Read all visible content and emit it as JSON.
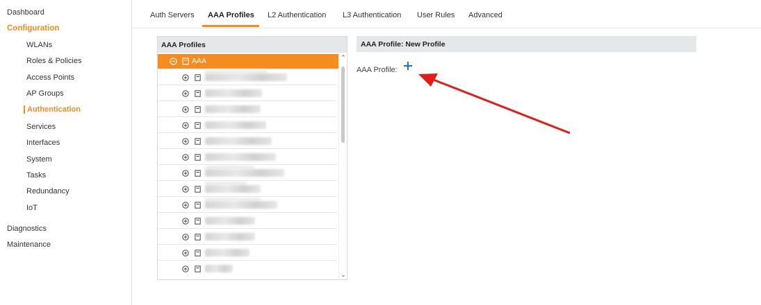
{
  "sidebar": {
    "dashboard": "Dashboard",
    "configuration": "Configuration",
    "items": [
      "WLANs",
      "Roles & Policies",
      "Access Points",
      "AP Groups",
      "Authentication",
      "Services",
      "Interfaces",
      "System",
      "Tasks",
      "Redundancy",
      "IoT"
    ],
    "diagnostics": "Diagnostics",
    "maintenance": "Maintenance"
  },
  "tabs": [
    "Auth Servers",
    "AAA Profiles",
    "L2 Authentication",
    "L3 Authentication",
    "User Rules",
    "Advanced"
  ],
  "left_panel": {
    "title": "AAA Profiles",
    "selected_label": "AAA"
  },
  "right_panel": {
    "title": "AAA Profile: New Profile",
    "field_label": "AAA Profile:"
  },
  "colors": {
    "accent": "#f68b1f",
    "add_icon": "#1a73c8",
    "annotation_arrow": "#e21b1b"
  }
}
